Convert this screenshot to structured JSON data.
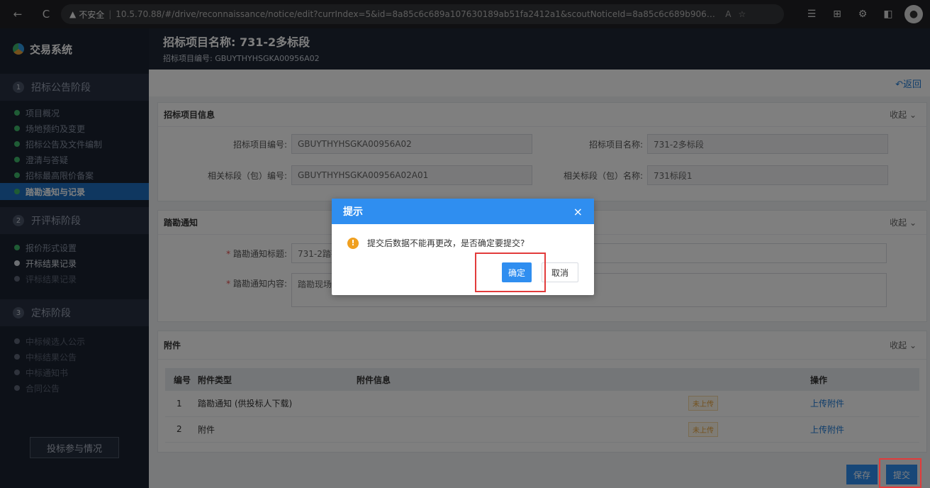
{
  "browser": {
    "back": "←",
    "reload": "C",
    "security_warn": "▲",
    "insecure_label": "不安全",
    "url": "10.5.70.88/#/drive/reconnaissance/notice/edit?currIndex=5&id=8a85c6c689a107630189ab51fa2412a1&scoutNoticeId=8a85c6c689b9068d0189ba0d4380...",
    "read_aloud": "A",
    "star": "☆"
  },
  "app": {
    "name": "交易系统"
  },
  "header": {
    "title": "招标项目名称: 731-2多标段",
    "subtitle": "招标项目编号: GBUYTHYHSGKA00956A02"
  },
  "sidebar": {
    "stages": [
      {
        "num": "1",
        "label": "招标公告阶段",
        "items": [
          {
            "label": "项目概况"
          },
          {
            "label": "场地预约及变更"
          },
          {
            "label": "招标公告及文件编制"
          },
          {
            "label": "澄清与答疑"
          },
          {
            "label": "招标最高限价备案"
          },
          {
            "label": "踏勘通知与记录"
          }
        ]
      },
      {
        "num": "2",
        "label": "开评标阶段",
        "items": [
          {
            "label": "报价形式设置"
          },
          {
            "label": "开标结果记录"
          },
          {
            "label": "评标结果记录"
          }
        ]
      },
      {
        "num": "3",
        "label": "定标阶段",
        "items": [
          {
            "label": "中标候选人公示"
          },
          {
            "label": "中标结果公告"
          },
          {
            "label": "中标通知书"
          },
          {
            "label": "合同公告"
          }
        ]
      }
    ],
    "bid_button": "投标参与情况"
  },
  "back_label": "↶返回",
  "project_info": {
    "title": "招标项目信息",
    "collapse": "收起 ⌄",
    "code_label": "招标项目编号:",
    "code_value": "GBUYTHYHSGKA00956A02",
    "name_label": "招标项目名称:",
    "name_value": "731-2多标段",
    "section_code_label": "相关标段（包）编号:",
    "section_code_value": "GBUYTHYHSGKA00956A02A01",
    "section_name_label": "相关标段（包）名称:",
    "section_name_value": "731标段1"
  },
  "notice": {
    "title": "踏勘通知",
    "collapse": "收起 ⌄",
    "required_mark": "*",
    "title_label": "踏勘通知标题:",
    "title_value": "731-2踏勘",
    "content_label": "踏勘通知内容:",
    "content_value": "踏勘现场"
  },
  "attachments": {
    "title": "附件",
    "collapse": "收起 ⌄",
    "headers": [
      "编号",
      "附件类型",
      "附件信息",
      "操作"
    ],
    "rows": [
      {
        "no": "1",
        "type": "踏勘通知 (供投标人下载)",
        "status": "未上传",
        "action": "上传附件"
      },
      {
        "no": "2",
        "type": "附件",
        "status": "未上传",
        "action": "上传附件"
      }
    ]
  },
  "footer": {
    "save": "保存",
    "submit": "提交"
  },
  "dialog": {
    "title": "提示",
    "close": "×",
    "icon": "!",
    "message": "提交后数据不能再更改，是否确定要提交?",
    "ok": "确定",
    "cancel": "取消"
  }
}
